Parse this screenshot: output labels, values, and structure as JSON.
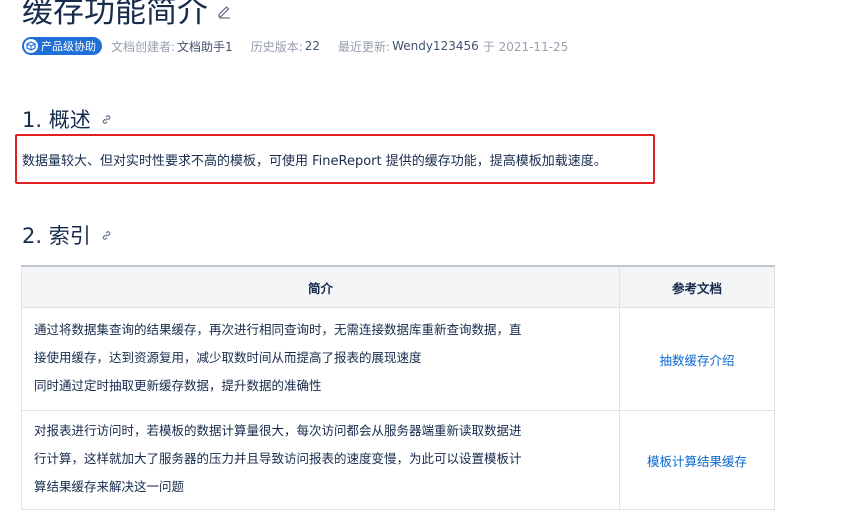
{
  "page": {
    "title": "缓存功能简介"
  },
  "meta": {
    "badge_label": "产品级协助",
    "creator_label": "文档创建者:",
    "creator_value": "文档助手1",
    "version_label": "历史版本:",
    "version_value": "22",
    "updated_label": "最近更新:",
    "updated_user": "Wendy123456",
    "updated_on": "于 2021-11-25"
  },
  "sections": [
    {
      "heading": "1. 概述"
    },
    {
      "heading": "2. 索引"
    }
  ],
  "overview": {
    "text": "数据量较大、但对实时性要求不高的模板，可使用 FineReport 提供的缓存功能，提高模板加载速度。"
  },
  "index_table": {
    "headers": [
      "简介",
      "参考文档"
    ],
    "rows": [
      {
        "lines": [
          "通过将数据集查询的结果缓存，再次进行相同查询时，无需连接数据库重新查询数据，直",
          "接使用缓存，达到资源复用，减少取数时间从而提高了报表的展现速度",
          "同时通过定时抽取更新缓存数据，提升数据的准确性"
        ],
        "link": "抽数缓存介绍"
      },
      {
        "lines": [
          "对报表进行访问时，若模板的数据计算量很大，每次访问都会从服务器端重新读取数据进",
          "行计算，这样就加大了服务器的压力并且导致访问报表的速度变慢，为此可以设置模板计",
          "算结果缓存来解决这一问题"
        ],
        "link": "模板计算结果缓存"
      }
    ]
  },
  "colors": {
    "badge": "#1f6fd8",
    "link": "#0a69d0",
    "highlight": "#e02020"
  }
}
